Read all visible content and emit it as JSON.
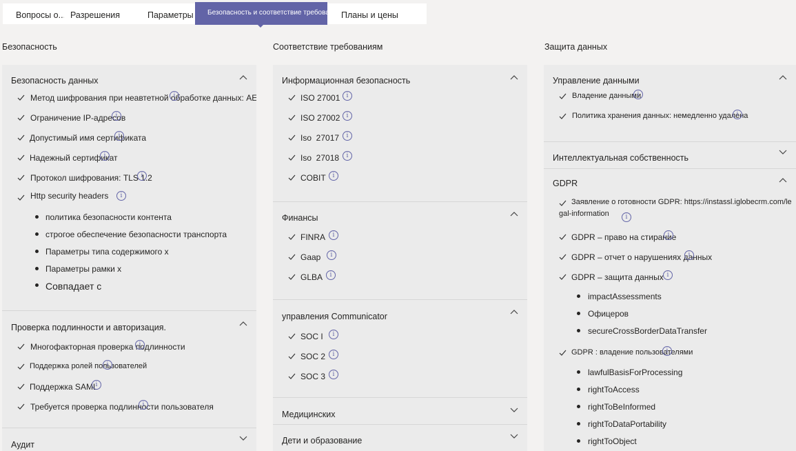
{
  "tabs": [
    {
      "label": "Вопросы о..."
    },
    {
      "label": "Разрешения"
    },
    {
      "label": "Параметры"
    },
    {
      "label": "Безопасность и соответствие требованиям"
    },
    {
      "label": "Планы и цены"
    }
  ],
  "columns": {
    "security": {
      "title": "Безопасность",
      "sections": [
        {
          "title": "Безопасность данных",
          "expanded": true,
          "items": [
            {
              "text": "Метод шифрования при неавтетной обработке данных: AES"
            },
            {
              "text": "Ограничение IP-адресов"
            },
            {
              "text": "Допустимый имя сертификата"
            },
            {
              "text": "Надежный сертификат"
            },
            {
              "text": "Протокол шифрования: TLS 1.2"
            },
            {
              "text": "Http security headers"
            }
          ],
          "subitems": [
            "политика безопасности контента",
            "строгое обеспечение безопасности транспорта",
            "Параметры типа содержимого x",
            "Параметры рамки x",
            "Совпадает с"
          ]
        },
        {
          "title": "Проверка подлинности и авторизация.",
          "expanded": true,
          "items": [
            {
              "text": "Многофакторная проверка подлинности"
            },
            {
              "text": "Поддержка ролей пользователей"
            },
            {
              "text": "Поддержка SAML"
            },
            {
              "text": "Требуется проверка подлинности пользователя"
            }
          ]
        },
        {
          "title": "Аудит",
          "expanded": false
        }
      ]
    },
    "compliance": {
      "title": "Соответствие требованиям",
      "sections": [
        {
          "title": "Информационная безопасность",
          "expanded": true,
          "items": [
            {
              "text": "ISO 27001"
            },
            {
              "text": "ISO 27002"
            },
            {
              "text": "Iso  27017"
            },
            {
              "text": "Iso  27018"
            },
            {
              "text": "COBIT"
            }
          ]
        },
        {
          "title": "Финансы",
          "expanded": true,
          "items": [
            {
              "text": "FINRA"
            },
            {
              "text": "Gaap"
            },
            {
              "text": "GLBA"
            }
          ]
        },
        {
          "title": "управления Communicator",
          "expanded": true,
          "items": [
            {
              "text": "SOC I"
            },
            {
              "text": "SOC 2"
            },
            {
              "text": "SOC 3"
            }
          ]
        },
        {
          "title": "Медицинских",
          "expanded": false
        },
        {
          "title": "Дети и образование",
          "expanded": false
        }
      ]
    },
    "privacy": {
      "title": "Защита данных",
      "sections": [
        {
          "title": "Управление данными",
          "expanded": true,
          "items": [
            {
              "text": "Владение данными"
            },
            {
              "text": "Политика хранения данных: немедленно удалена"
            }
          ]
        },
        {
          "title": "Интеллектуальная собственность",
          "expanded": false
        },
        {
          "title": "GDPR",
          "expanded": true,
          "readiness": {
            "line1": "Заявление о готовности GDPR: https://instassl.iglobecrm.com/le",
            "line2": "gal-information"
          },
          "items": [
            {
              "text": "GDPR – право на стирание"
            },
            {
              "text": "GDPR – отчет о нарушениях данных"
            },
            {
              "text": "GDPR – защита данных"
            }
          ],
          "protection_sub": [
            "impactAssessments",
            "Офицеров",
            "secureCrossBorderDataTransfer"
          ],
          "ownership": {
            "text": "GDPR : владение пользователями"
          },
          "ownership_sub": [
            "lawfulBasisForProcessing",
            "rightToAccess",
            "rightToBeInformed",
            "rightToDataPortability",
            "rightToObject"
          ]
        }
      ]
    }
  },
  "icons": {
    "check": "check-icon",
    "info": "info-icon",
    "chevron_up": "chevron-up-icon",
    "chevron_down": "chevron-down-icon"
  },
  "colors": {
    "accent": "#6264a7",
    "panel": "#ebebeb",
    "background": "#f3f2f1"
  }
}
